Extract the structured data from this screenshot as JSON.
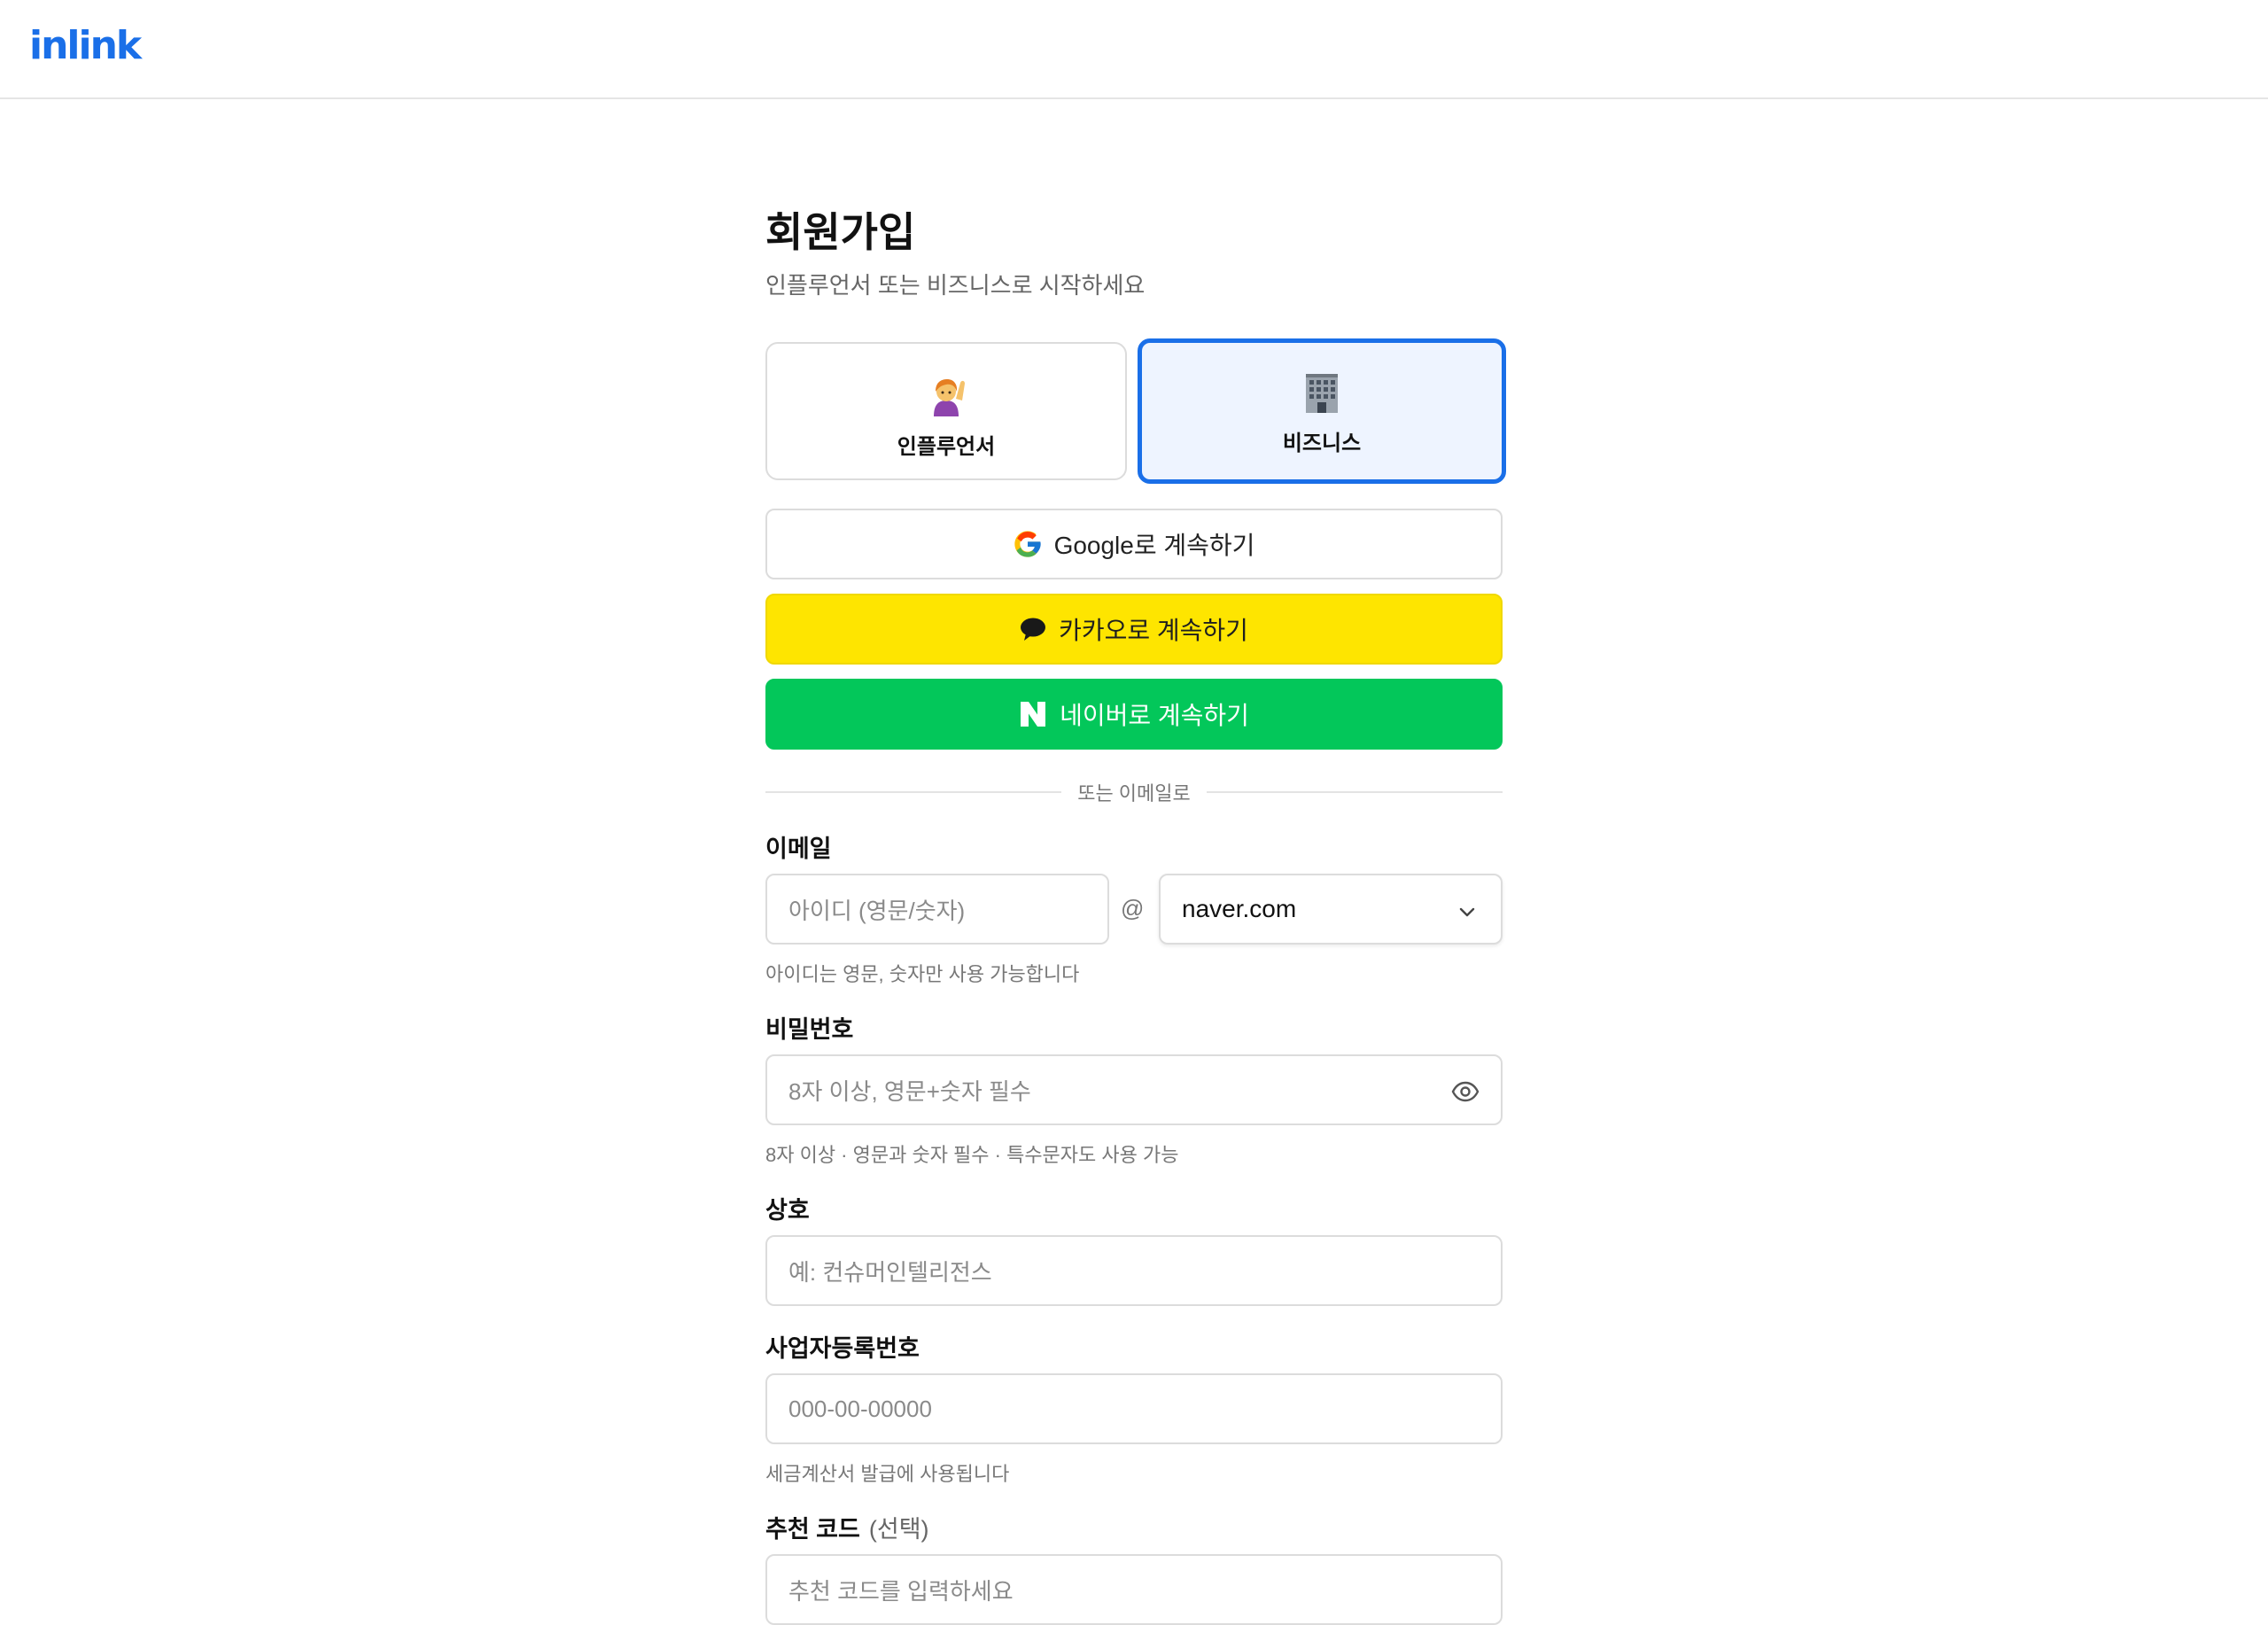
{
  "header": {
    "logo": "inlink"
  },
  "page": {
    "title": "회원가입",
    "subtitle": "인플루언서 또는 비즈니스로 시작하세요"
  },
  "account_types": [
    {
      "label": "인플루언서",
      "emoji": "🙋‍♀️",
      "selected": false
    },
    {
      "label": "비즈니스",
      "emoji": "🏢",
      "selected": true
    }
  ],
  "social": {
    "google": "Google로 계속하기",
    "kakao": "카카오로 계속하기",
    "naver": "네이버로 계속하기"
  },
  "divider": "또는 이메일로",
  "email": {
    "label": "이메일",
    "id_placeholder": "아이디 (영문/숫자)",
    "at": "@",
    "domain_selected": "naver.com",
    "helper": "아이디는 영문, 숫자만 사용 가능합니다"
  },
  "password": {
    "label": "비밀번호",
    "placeholder": "8자 이상, 영문+숫자 필수",
    "helper": "8자 이상 · 영문과 숫자 필수 · 특수문자도 사용 가능"
  },
  "company": {
    "label": "상호",
    "placeholder": "예: 컨슈머인텔리전스"
  },
  "biz_number": {
    "label": "사업자등록번호",
    "placeholder": "000-00-00000",
    "helper": "세금계산서 발급에 사용됩니다"
  },
  "referral": {
    "label": "추천 코드",
    "optional": "(선택)",
    "placeholder": "추천 코드를 입력하세요"
  },
  "colors": {
    "brand": "#1a6fe8",
    "kakao": "#fee500",
    "naver": "#03c75a"
  }
}
